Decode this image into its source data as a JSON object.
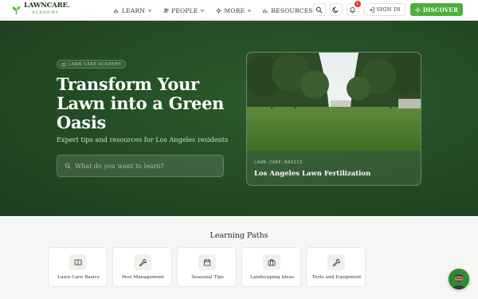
{
  "brand": {
    "name": "LAWNCARE.",
    "subtitle": "ACADEMY"
  },
  "nav": {
    "items": [
      {
        "label": "LEARN",
        "icon": "chart-icon"
      },
      {
        "label": "PEOPLE",
        "icon": "users-icon"
      },
      {
        "label": "MORE",
        "icon": "sparkle-icon"
      },
      {
        "label": "RESOURCES",
        "icon": "chart-icon"
      }
    ],
    "notification_count": "1",
    "signin_label": "SIGN IN",
    "discover_label": "DISCOVER"
  },
  "hero": {
    "tag": "LAWN CARE ACADEMY",
    "title": "Transform Your Lawn into a Green Oasis",
    "subtitle": "Expert tips and resources for Los Angeles residents",
    "search_placeholder": "What do you want to learn?",
    "featured": {
      "category": "LAWN-CARE-BASICS",
      "title": "Los Angeles Lawn Fertilization"
    }
  },
  "paths": {
    "title": "Learning Paths",
    "items": [
      {
        "label": "Lawn Care Basics",
        "icon": "book-icon"
      },
      {
        "label": "Pest Management",
        "icon": "wrench-icon"
      },
      {
        "label": "Seasonal Tips",
        "icon": "calendar-icon"
      },
      {
        "label": "Landscaping Ideas",
        "icon": "briefcase-icon"
      },
      {
        "label": "Tools and Equipment",
        "icon": "wrench-icon"
      }
    ]
  },
  "colors": {
    "accent": "#4caf3a",
    "hero_bg": "#234a24",
    "badge": "#e03c31"
  }
}
